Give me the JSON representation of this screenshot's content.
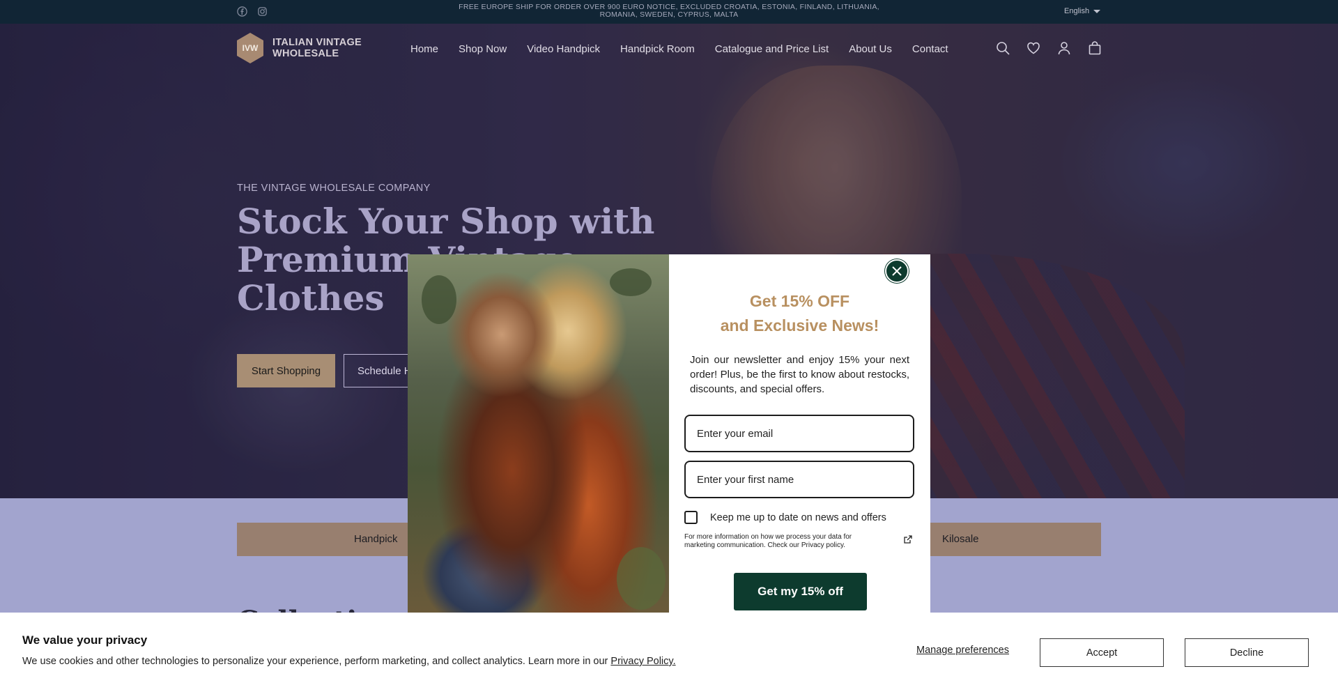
{
  "topbar": {
    "social": [
      "facebook-icon",
      "instagram-icon"
    ],
    "announcement": "FREE EUROPE SHIP FOR ORDER OVER 900 EURO NOTICE, EXCLUDED CROATIA, ESTONIA, FINLAND, LITHUANIA, ROMANIA, SWEDEN, CYPRUS, MALTA",
    "language": "English"
  },
  "header": {
    "logo_mark": "IVW",
    "logo_line1": "ITALIAN VINTAGE",
    "logo_line2": "WHOLESALE",
    "menu": [
      "Home",
      "Shop Now",
      "Video Handpick",
      "Handpick Room",
      "Catalogue and Price List",
      "About Us",
      "Contact"
    ],
    "icons": [
      "search-icon",
      "heart-icon",
      "account-icon",
      "bag-icon"
    ]
  },
  "hero": {
    "eyebrow": "THE VINTAGE WHOLESALE COMPANY",
    "headline_line1": "Stock Your Shop with",
    "headline_line2": "Premium Vintage",
    "headline_line3": "Clothes",
    "primary_button": "Start Shopping",
    "secondary_button": "Schedule Handpick"
  },
  "categories": {
    "left": "Handpick",
    "right": "Kilosale"
  },
  "collections_title": "Collections",
  "popup": {
    "title_line1": "Get 15% OFF",
    "title_line2": "and Exclusive News!",
    "body": "Join our newsletter and enjoy 15% your next order! Plus, be the first to know about restocks, discounts, and special offers.",
    "email_placeholder": "Enter your email",
    "name_placeholder": "Enter your first name",
    "checkbox_label": "Keep me up to date on news and offers",
    "privacy_text": "For more information on how we process your data for marketing communication. Check our Privacy policy.",
    "cta": "Get my 15% off"
  },
  "cookie": {
    "title": "We value your privacy",
    "text": "We use cookies and other technologies to personalize your experience, perform marketing, and collect analytics. Learn more in our ",
    "link": "Privacy Policy.",
    "manage": "Manage preferences",
    "accept": "Accept",
    "decline": "Decline"
  },
  "colors": {
    "topbar_bg": "#0e2531",
    "accent_tan": "#a88e74",
    "popup_title": "#b89060",
    "popup_cta": "#0d3b2e"
  }
}
